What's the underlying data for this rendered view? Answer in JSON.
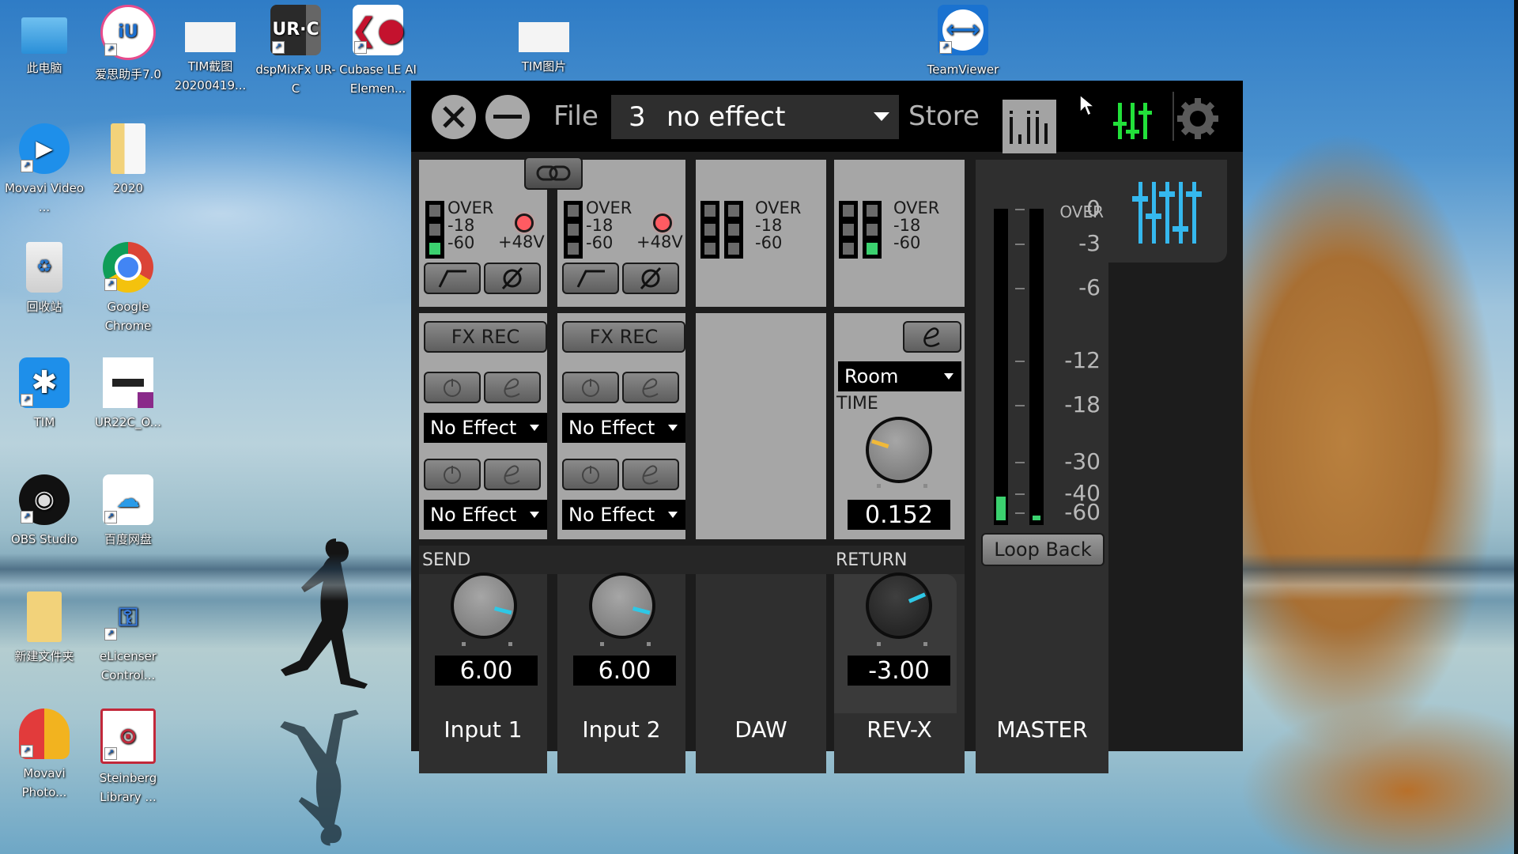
{
  "desktop": {
    "icons": [
      {
        "label": "此电脑",
        "icon": "computer-icon"
      },
      {
        "label": "爱思助手7.0",
        "icon": "i4-assistant-icon"
      },
      {
        "label": "TIM截图 20200419...",
        "icon": "screenshot-file-icon"
      },
      {
        "label": "dspMixFx UR-C",
        "icon": "urc-app-icon"
      },
      {
        "label": "Cubase LE AI Elemen...",
        "icon": "cubase-icon"
      },
      {
        "label": "TIM图片",
        "icon": "image-file-icon"
      },
      {
        "label": "TeamViewer",
        "icon": "teamviewer-icon"
      },
      {
        "label": "Movavi Video ...",
        "icon": "movavi-video-icon"
      },
      {
        "label": "2020",
        "icon": "folder-icon"
      },
      {
        "label": "回收站",
        "icon": "recycle-bin-icon"
      },
      {
        "label": "Google Chrome",
        "icon": "chrome-icon"
      },
      {
        "label": "TIM",
        "icon": "tim-icon"
      },
      {
        "label": "UR22C_O...",
        "icon": "pdf-file-icon"
      },
      {
        "label": "OBS Studio",
        "icon": "obs-icon"
      },
      {
        "label": "百度网盘",
        "icon": "baidu-netdisk-icon"
      },
      {
        "label": "新建文件夹",
        "icon": "folder-icon"
      },
      {
        "label": "eLicenser Control...",
        "icon": "elicenser-icon"
      },
      {
        "label": "Movavi Photo...",
        "icon": "movavi-photo-icon"
      },
      {
        "label": "Steinberg Library ...",
        "icon": "steinberg-library-icon"
      }
    ]
  },
  "mixer": {
    "toolbar": {
      "file_label": "File",
      "scene_number": "3",
      "scene_name": "no effect",
      "store_label": "Store"
    },
    "channels": [
      {
        "name": "Input 1",
        "meter": {
          "scale": [
            "OVER",
            "-18",
            "-60"
          ],
          "leds": [
            false,
            false,
            true
          ]
        },
        "phantom_label": "+48V",
        "phantom_on": true,
        "fx_rec_label": "FX REC",
        "effect_slots": [
          "No Effect",
          "No Effect"
        ],
        "send_label": "SEND",
        "send_value": "6.00",
        "send_knob_position": 0.78
      },
      {
        "name": "Input 2",
        "meter": {
          "scale": [
            "OVER",
            "-18",
            "-60"
          ],
          "leds": [
            false,
            false,
            false
          ]
        },
        "phantom_label": "+48V",
        "phantom_on": true,
        "fx_rec_label": "FX REC",
        "effect_slots": [
          "No Effect",
          "No Effect"
        ],
        "send_value": "6.00",
        "send_knob_position": 0.78
      },
      {
        "name": "DAW",
        "meter": {
          "scale": [
            "OVER",
            "-18",
            "-60"
          ],
          "leds_l": [
            false,
            false,
            false
          ],
          "leds_r": [
            false,
            false,
            false
          ]
        }
      },
      {
        "name": "REV-X",
        "meter": {
          "scale": [
            "OVER",
            "-18",
            "-60"
          ],
          "leds_l": [
            false,
            false,
            false
          ],
          "leds_r": [
            false,
            false,
            true
          ]
        },
        "reverb_type": "Room",
        "time_label": "TIME",
        "time_value": "0.152",
        "time_knob_position": 0.1,
        "return_label": "RETURN",
        "return_value": "-3.00",
        "return_knob_position": 0.92
      }
    ],
    "master": {
      "name": "MASTER",
      "scale": [
        "OVER",
        "0",
        "-3",
        "-6",
        "-12",
        "-18",
        "-30",
        "-40",
        "-60"
      ],
      "level_l_db": -60,
      "peak_l_db": -40,
      "level_r_db": -60,
      "loopback_label": "Loop Back"
    },
    "colors": {
      "accent_cyan": "#2ec8e6",
      "accent_yellow": "#f0b93a",
      "led_green": "#3bd16f",
      "phantom_red": "#ff5b62",
      "mixer_view_green": "#22e03a",
      "master_icon_blue": "#35b8ee"
    }
  }
}
